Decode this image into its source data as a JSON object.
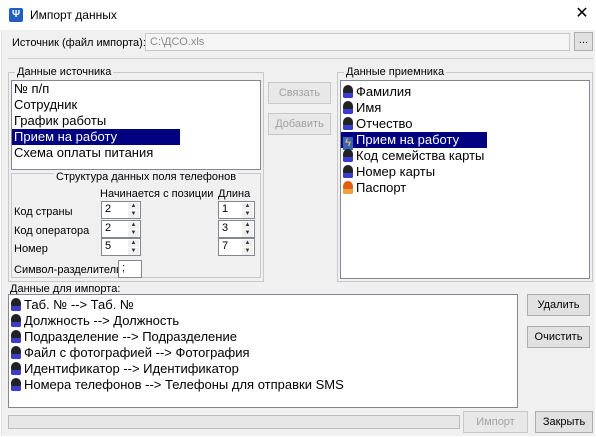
{
  "window": {
    "title": "Импорт данных",
    "icon": "app-logo-icon",
    "close": "✕"
  },
  "source": {
    "label": "Источник (файл импорта):",
    "value": "C:\\ДСО.xls",
    "browse_label": "..."
  },
  "source_data": {
    "legend": "Данные источника",
    "items": [
      "№ п/п",
      "Сотрудник",
      "График работы",
      "Прием на работу",
      "Схема оплаты питания"
    ],
    "selected": "Прием на работу"
  },
  "buttons": {
    "link": "Связать",
    "add": "Добавить",
    "delete": "Удалить",
    "clear": "Очистить",
    "import": "Импорт",
    "close": "Закрыть"
  },
  "phone": {
    "title": "Структура данных поля телефонов",
    "col_start": "Начинается с позиции",
    "col_length": "Длина",
    "rows": [
      {
        "label": "Код страны",
        "start": "2",
        "length": "1"
      },
      {
        "label": "Код оператора",
        "start": "2",
        "length": "3"
      },
      {
        "label": "Номер",
        "start": "5",
        "length": "7"
      }
    ],
    "separator_label": "Символ-разделитель",
    "separator_value": ";"
  },
  "receiver": {
    "legend": "Данные приемника",
    "items": [
      {
        "label": "Фамилия",
        "icon": "person-icon"
      },
      {
        "label": "Имя",
        "icon": "person-icon"
      },
      {
        "label": "Отчество",
        "icon": "person-icon"
      },
      {
        "label": "Прием на работу",
        "icon": "lightning-icon"
      },
      {
        "label": "Код семейства карты",
        "icon": "person-icon"
      },
      {
        "label": "Номер карты",
        "icon": "person-icon"
      },
      {
        "label": "Паспорт",
        "icon": "person-orange-icon"
      }
    ],
    "selected": "Прием на работу"
  },
  "import_data": {
    "label": "Данные для импорта:",
    "items": [
      "Таб. № --> Таб. №",
      "Должность  --> Должность",
      "Подразделение --> Подразделение",
      "Файл с фотографией --> Фотография",
      "Идентификатор --> Идентификатор",
      "Номера телефонов --> Телефоны для отправки SMS"
    ]
  },
  "colors": {
    "selection": "#000080",
    "window_bg": "#f0f0f0"
  }
}
